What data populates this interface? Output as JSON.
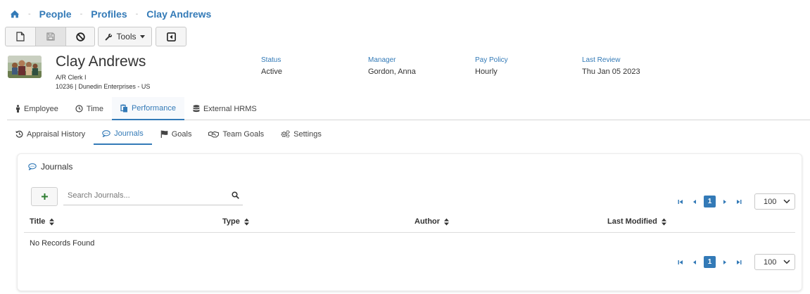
{
  "breadcrumb": {
    "home_icon": "home-icon",
    "items": [
      {
        "label": "People"
      },
      {
        "label": "Profiles"
      },
      {
        "label": "Clay Andrews"
      }
    ]
  },
  "toolbar": {
    "new_icon": "file-icon",
    "save_icon": "save-icon",
    "cancel_icon": "ban-icon",
    "tools_label": "Tools",
    "collapse_icon": "caret-square-left-icon"
  },
  "profile": {
    "name": "Clay Andrews",
    "title": "A/R Clerk I",
    "org": "10236 | Dunedin Enterprises - US",
    "fields": [
      {
        "label": "Status",
        "value": "Active"
      },
      {
        "label": "Manager",
        "value": "Gordon, Anna"
      },
      {
        "label": "Pay Policy",
        "value": "Hourly"
      },
      {
        "label": "Last Review",
        "value": "Thu Jan 05 2023"
      }
    ]
  },
  "main_tabs": [
    {
      "label": "Employee",
      "icon": "person-icon"
    },
    {
      "label": "Time",
      "icon": "clock-icon"
    },
    {
      "label": "Performance",
      "icon": "clipboard-icon",
      "active": true
    },
    {
      "label": "External HRMS",
      "icon": "database-icon"
    }
  ],
  "sub_tabs": [
    {
      "label": "Appraisal History",
      "icon": "history-icon"
    },
    {
      "label": "Journals",
      "icon": "comment-icon",
      "active": true
    },
    {
      "label": "Goals",
      "icon": "flag-icon"
    },
    {
      "label": "Team Goals",
      "icon": "handshake-icon"
    },
    {
      "label": "Settings",
      "icon": "cogs-icon"
    }
  ],
  "journals": {
    "title": "Journals",
    "search_placeholder": "Search Journals...",
    "columns": [
      "Title",
      "Type",
      "Author",
      "Last Modified"
    ],
    "empty_text": "No Records Found",
    "pager": {
      "current_page": "1",
      "page_size": "100"
    }
  },
  "colors": {
    "accent": "#337ab7",
    "add_green": "#2e7d32"
  }
}
